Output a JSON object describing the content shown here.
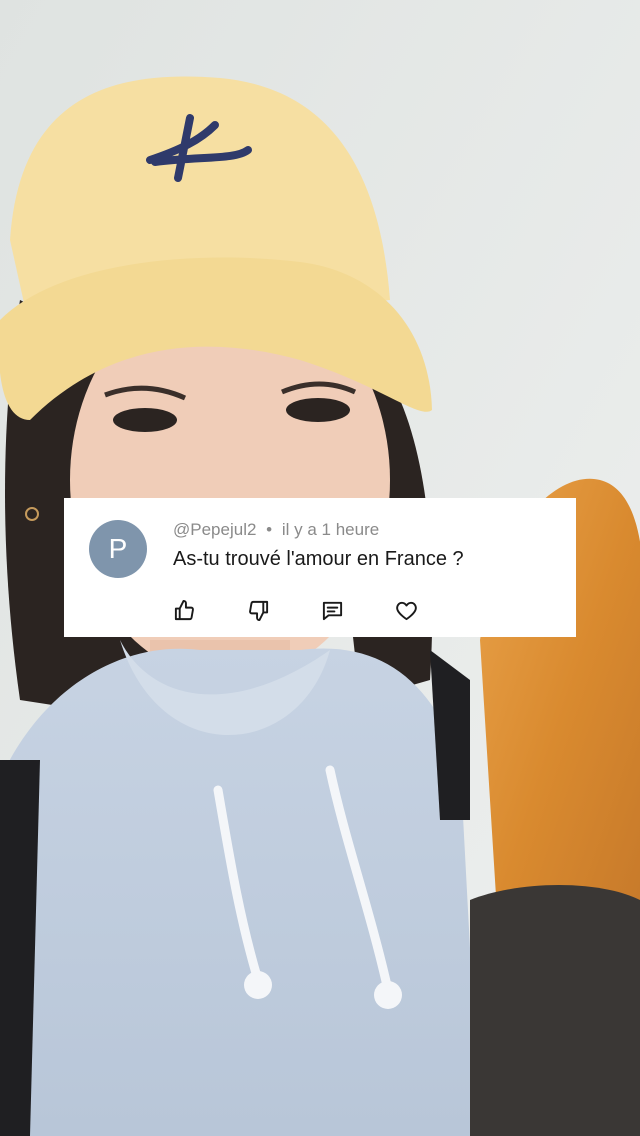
{
  "comment": {
    "avatar_letter": "P",
    "username": "@Pepejul2",
    "separator": "•",
    "timestamp": "il y a 1 heure",
    "text": "As-tu trouvé l'amour en France ?",
    "actions": [
      {
        "icon": "thumbs-up-icon"
      },
      {
        "icon": "thumbs-down-icon"
      },
      {
        "icon": "reply-comment-icon"
      },
      {
        "icon": "heart-icon"
      }
    ],
    "colors": {
      "avatar": "#7f95ac",
      "card": "#ffffff",
      "meta_text": "#8a8a8a",
      "body_text": "#1a1a1a"
    }
  }
}
